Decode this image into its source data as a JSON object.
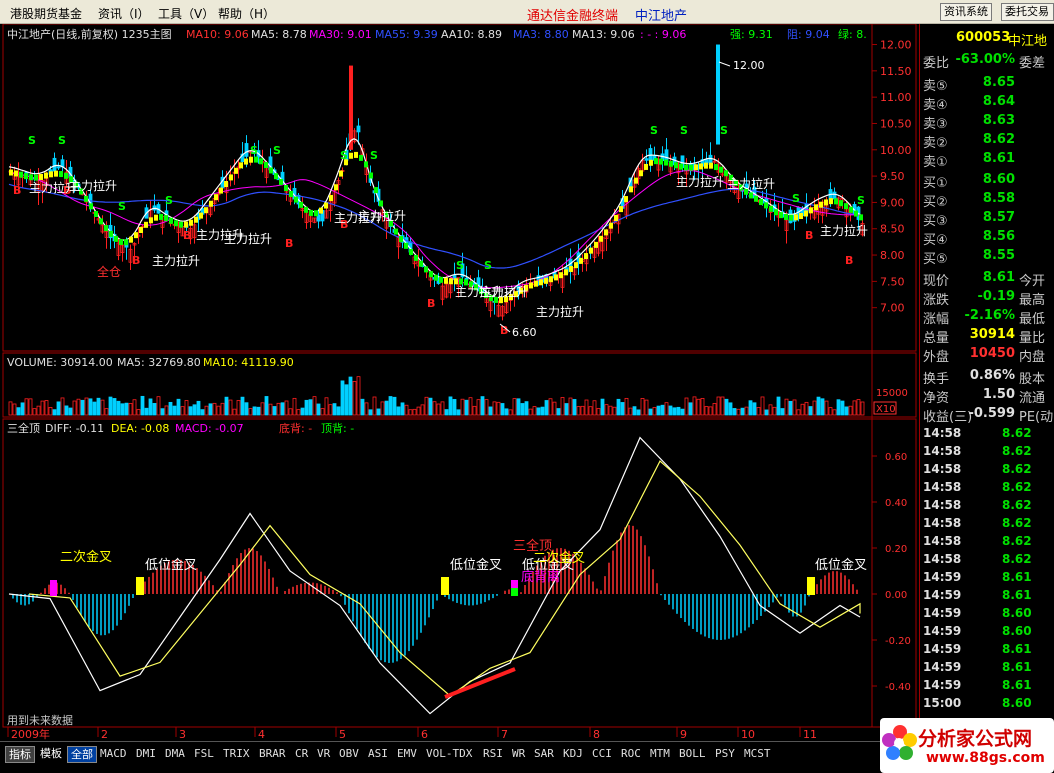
{
  "menu": {
    "items": [
      "港股期货基金",
      "资讯（I）",
      "工具（V）",
      "帮助（H）"
    ]
  },
  "app_title": "通达信金融终端",
  "stock_name_title": "中江地产",
  "toolbar": {
    "btn1": "资讯系统",
    "btn2": "委托交易"
  },
  "main_chart": {
    "title": "中江地产(日线,前复权) 1235主图",
    "ma10": "MA10: 9.06",
    "ma5": "MA5: 8.78",
    "ma30": "MA30: 9.01",
    "ma55": "MA55: 9.39",
    "aa10": "AA10: 8.89",
    "ma3": "MA3: 8.80",
    "ma13": "MA13: 9.06",
    "dash": ": - : 9.06",
    "qiang": "强: 9.31",
    "zu": "阻: 9.04",
    "lu": "绿: 8.",
    "high_label": "12.00",
    "low_label": "6.60",
    "zhu_li": "主力拉升",
    "quan_cang": "全仓",
    "price_ticks": [
      "12.00",
      "11.50",
      "11.00",
      "10.50",
      "10.00",
      "9.50",
      "9.00",
      "8.50",
      "8.00",
      "7.50",
      "7.00"
    ],
    "colors": {
      "up": "#ff2020",
      "down": "#00d0ff",
      "yellow": "#ffff00",
      "green": "#00ff00",
      "purple": "#ff00ff"
    }
  },
  "volume_chart": {
    "title": "VOLUME: 30914.00",
    "ma5": "MA5: 32769.80",
    "ma10": "MA10: 41119.90",
    "tick": "15000",
    "x10": "X10"
  },
  "macd_chart": {
    "title": "三全顶",
    "diff": "DIFF: -0.11",
    "dea": "DEA: -0.08",
    "macd": "MACD: -0.07",
    "di_bei": "底背: -",
    "ding_bei": "顶背: -",
    "labels": {
      "er_ci": "二次金叉",
      "di_wei": "低位金叉",
      "san_quan": "三全顶",
      "di_bei_text": "底背离"
    },
    "ticks": [
      "0.60",
      "0.40",
      "0.20",
      "0.00",
      "-0.20",
      "-0.40"
    ],
    "future_text": "用到未来数据"
  },
  "x_axis": {
    "months": [
      "2009年",
      "2",
      "3",
      "4",
      "5",
      "6",
      "7",
      "8",
      "9",
      "10",
      "11"
    ]
  },
  "right_panel": {
    "code": "600053",
    "name": "中江地",
    "wei_bi": {
      "label": "委比",
      "value": "-63.00%",
      "extra": "委差"
    },
    "sell": [
      {
        "label": "卖⑤",
        "price": "8.65"
      },
      {
        "label": "卖④",
        "price": "8.64"
      },
      {
        "label": "卖③",
        "price": "8.63"
      },
      {
        "label": "卖②",
        "price": "8.62"
      },
      {
        "label": "卖①",
        "price": "8.61"
      }
    ],
    "buy": [
      {
        "label": "买①",
        "price": "8.60"
      },
      {
        "label": "买②",
        "price": "8.58"
      },
      {
        "label": "买③",
        "price": "8.57"
      },
      {
        "label": "买④",
        "price": "8.56"
      },
      {
        "label": "买⑤",
        "price": "8.55"
      }
    ],
    "stats": [
      {
        "label": "现价",
        "value": "8.61",
        "extra": "今开",
        "color": "#00e000"
      },
      {
        "label": "涨跌",
        "value": "-0.19",
        "extra": "最高",
        "color": "#00e000"
      },
      {
        "label": "涨幅",
        "value": "-2.16%",
        "extra": "最低",
        "color": "#00e000"
      },
      {
        "label": "总量",
        "value": "30914",
        "extra": "量比",
        "color": "#ffff00"
      },
      {
        "label": "外盘",
        "value": "10450",
        "extra": "内盘",
        "color": "#ff3030"
      },
      {
        "label": "换手",
        "value": "0.86%",
        "extra": "股本",
        "color": "#e0e0e0"
      },
      {
        "label": "净资",
        "value": "1.50",
        "extra": "流通",
        "color": "#e0e0e0"
      },
      {
        "label": "收益(三)",
        "value": "-0.599",
        "extra": "PE(动",
        "color": "#e0e0e0"
      }
    ],
    "ticks": [
      {
        "time": "14:58",
        "price": "8.62"
      },
      {
        "time": "14:58",
        "price": "8.62"
      },
      {
        "time": "14:58",
        "price": "8.62"
      },
      {
        "time": "14:58",
        "price": "8.62"
      },
      {
        "time": "14:58",
        "price": "8.62"
      },
      {
        "time": "14:58",
        "price": "8.62"
      },
      {
        "time": "14:58",
        "price": "8.62"
      },
      {
        "time": "14:58",
        "price": "8.62"
      },
      {
        "time": "14:59",
        "price": "8.61"
      },
      {
        "time": "14:59",
        "price": "8.61"
      },
      {
        "time": "14:59",
        "price": "8.60"
      },
      {
        "time": "14:59",
        "price": "8.60"
      },
      {
        "time": "14:59",
        "price": "8.61"
      },
      {
        "time": "14:59",
        "price": "8.61"
      },
      {
        "time": "14:59",
        "price": "8.61"
      },
      {
        "time": "15:00",
        "price": "8.60"
      }
    ]
  },
  "tabbar": {
    "tabs": [
      "指标",
      "模板",
      "全部"
    ],
    "indicators": [
      "MACD",
      "DMI",
      "DMA",
      "FSL",
      "TRIX",
      "BRAR",
      "CR",
      "VR",
      "OBV",
      "ASI",
      "EMV",
      "VOL-TDX",
      "RSI",
      "WR",
      "SAR",
      "KDJ",
      "CCI",
      "ROC",
      "MTM",
      "BOLL",
      "PSY",
      "MCST"
    ]
  },
  "logo": {
    "text": "分析家公式网",
    "url": "www.88gs.com"
  }
}
